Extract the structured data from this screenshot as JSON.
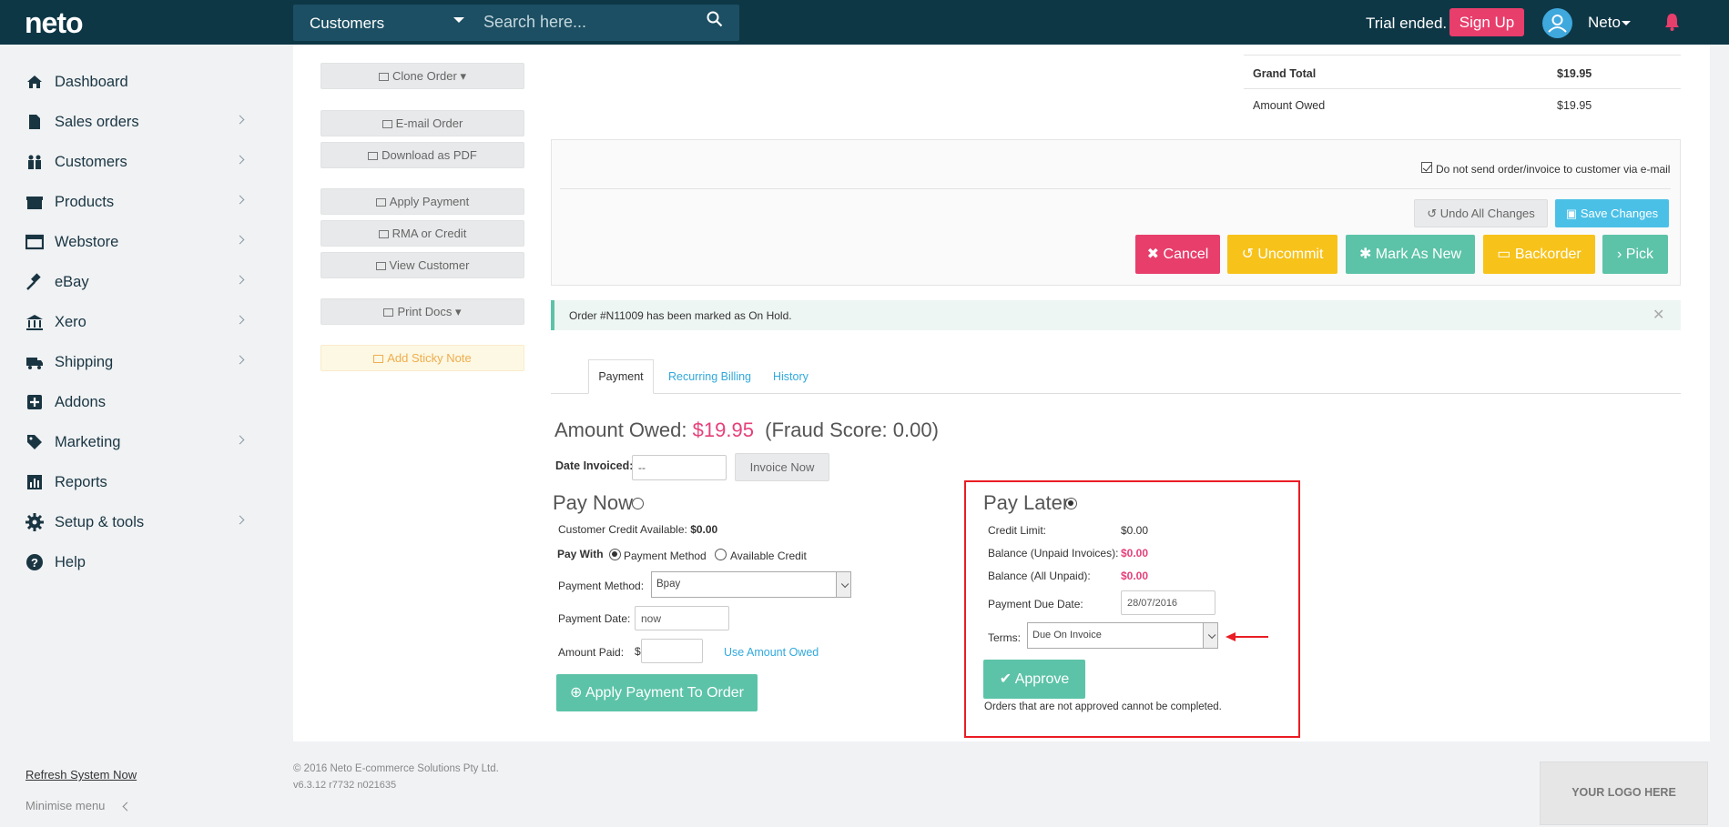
{
  "topbar": {
    "logo": "neto",
    "search_category": "Customers",
    "search_placeholder": "Search here...",
    "trial": "Trial ended.",
    "signup": "Sign Up",
    "user": "Neto"
  },
  "sidebar": {
    "items": [
      {
        "label": "Dashboard",
        "icon": "home-icon",
        "chevron": false
      },
      {
        "label": "Sales orders",
        "icon": "file-icon",
        "chevron": true
      },
      {
        "label": "Customers",
        "icon": "users-icon",
        "chevron": true
      },
      {
        "label": "Products",
        "icon": "gift-icon",
        "chevron": true
      },
      {
        "label": "Webstore",
        "icon": "window-icon",
        "chevron": true
      },
      {
        "label": "eBay",
        "icon": "gavel-icon",
        "chevron": true
      },
      {
        "label": "Xero",
        "icon": "bank-icon",
        "chevron": true
      },
      {
        "label": "Shipping",
        "icon": "truck-icon",
        "chevron": true
      },
      {
        "label": "Addons",
        "icon": "plus-square-icon",
        "chevron": false
      },
      {
        "label": "Marketing",
        "icon": "tag-icon",
        "chevron": true
      },
      {
        "label": "Reports",
        "icon": "bar-chart-icon",
        "chevron": false
      },
      {
        "label": "Setup & tools",
        "icon": "gear-icon",
        "chevron": true
      },
      {
        "label": "Help",
        "icon": "question-circle-icon",
        "chevron": false
      }
    ],
    "refresh": "Refresh System Now",
    "minimise": "Minimise menu"
  },
  "left_actions": {
    "clone": "Clone Order",
    "email": "E-mail Order",
    "pdf": "Download as PDF",
    "apply_payment": "Apply Payment",
    "rma": "RMA or Credit",
    "view_customer": "View Customer",
    "print": "Print Docs",
    "sticky": "Add Sticky Note"
  },
  "totals": {
    "grand_total_label": "Grand Total",
    "grand_total": "$19.95",
    "amount_owed_label": "Amount Owed",
    "amount_owed": "$19.95"
  },
  "panel": {
    "no_send": "Do not send order/invoice to customer via e-mail",
    "undo": "Undo All Changes",
    "save": "Save Changes",
    "cancel": "Cancel",
    "uncommit": "Uncommit",
    "mark_new": "Mark As New",
    "backorder": "Backorder",
    "pick": "Pick",
    "colors": {
      "cancel": "#e83e6c",
      "uncommit": "#f7c21a",
      "mark_new": "#5cc3a8",
      "backorder": "#f7c21a",
      "pick": "#5cc3a8"
    }
  },
  "alert": {
    "text": "Order #N11009 has been marked as On Hold."
  },
  "tabs": [
    "Payment",
    "Recurring Billing",
    "History"
  ],
  "payment": {
    "amount_owed_label": "Amount Owed:",
    "amount_owed_value": "$19.95",
    "fraud": "(Fraud Score: 0.00)",
    "date_invoiced_label": "Date Invoiced:",
    "date_invoiced_value": "--",
    "invoice_now": "Invoice Now",
    "pay_now": "Pay Now",
    "credit_available_label": "Customer Credit Available:",
    "credit_available_value": "$0.00",
    "pay_with": "Pay With",
    "opt_method": "Payment Method",
    "opt_credit": "Available Credit",
    "method_label": "Payment Method:",
    "method_value": "Bpay",
    "date_label": "Payment Date:",
    "date_value": "now",
    "amount_label": "Amount Paid:",
    "currency": "$",
    "use_amount": "Use Amount Owed",
    "apply": "Apply Payment To Order"
  },
  "pay_later": {
    "title": "Pay Later",
    "credit_limit_label": "Credit Limit:",
    "credit_limit": "$0.00",
    "bal_unpaid_label": "Balance (Unpaid Invoices):",
    "bal_unpaid": "$0.00",
    "bal_all_label": "Balance (All Unpaid):",
    "bal_all": "$0.00",
    "due_label": "Payment Due Date:",
    "due_value": "28/07/2016",
    "terms_label": "Terms:",
    "terms_value": "Due On Invoice",
    "approve": "Approve",
    "note": "Orders that are not approved cannot be completed."
  },
  "footer": {
    "copyright": "© 2016 Neto E-commerce Solutions Pty Ltd.",
    "version": "v6.3.12 r7732 n021635",
    "logo_placeholder": "YOUR LOGO HERE"
  }
}
